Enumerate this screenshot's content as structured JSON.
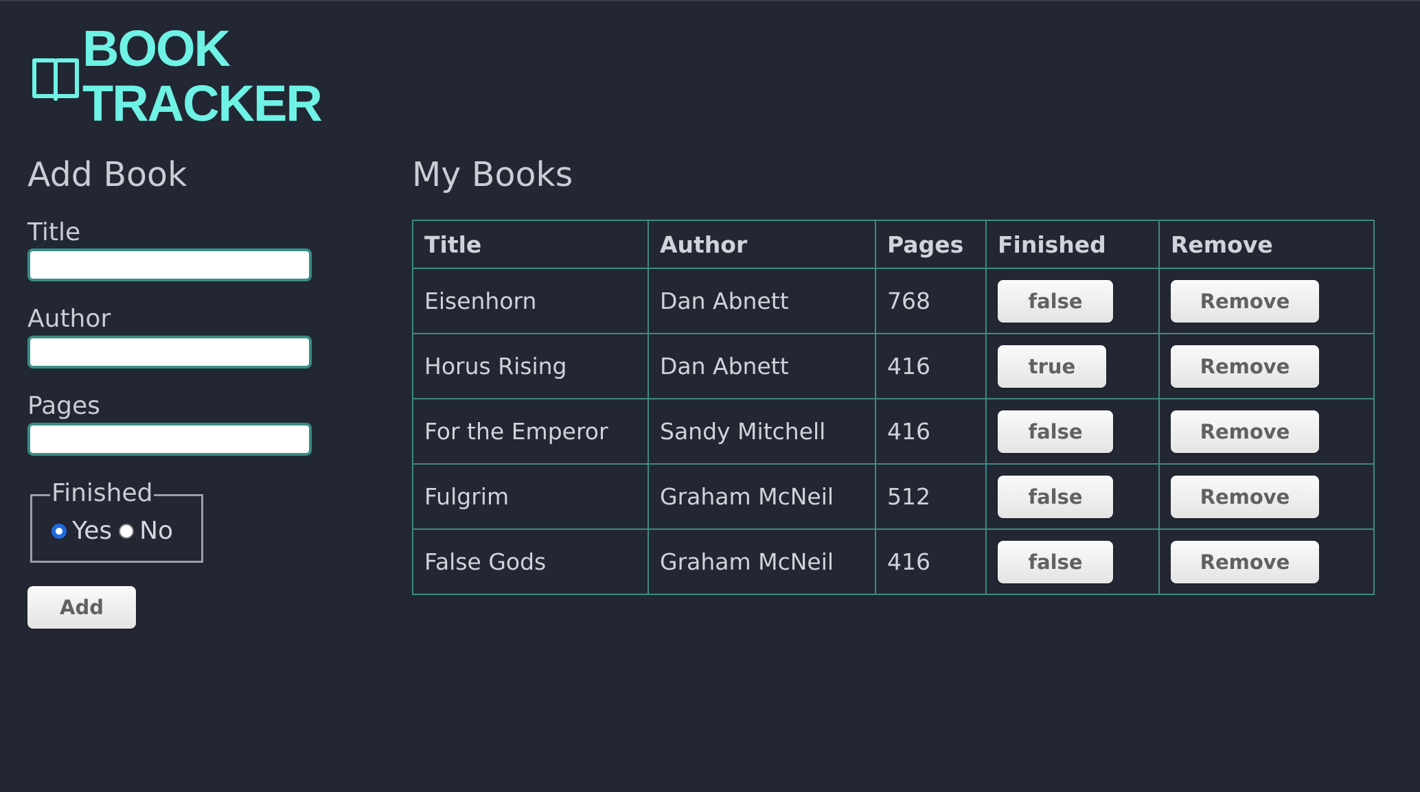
{
  "app": {
    "logo_line1": "BOOK",
    "logo_line2": "TRACKER",
    "logo_icon": "open-book-icon",
    "accent_color": "#6ff2e6",
    "background_color": "#222733"
  },
  "add_book": {
    "heading": "Add Book",
    "title_label": "Title",
    "title_value": "",
    "author_label": "Author",
    "author_value": "",
    "pages_label": "Pages",
    "pages_value": "",
    "finished_legend": "Finished",
    "yes_label": "Yes",
    "no_label": "No",
    "finished_selected": "Yes",
    "add_label": "Add"
  },
  "my_books": {
    "heading": "My Books",
    "columns": [
      "Title",
      "Author",
      "Pages",
      "Finished",
      "Remove"
    ],
    "rows": [
      {
        "title": "Eisenhorn",
        "author": "Dan Abnett",
        "pages": "768",
        "finished": "false",
        "remove": "Remove"
      },
      {
        "title": "Horus Rising",
        "author": "Dan Abnett",
        "pages": "416",
        "finished": "true",
        "remove": "Remove"
      },
      {
        "title": "For the Emperor",
        "author": "Sandy Mitchell",
        "pages": "416",
        "finished": "false",
        "remove": "Remove"
      },
      {
        "title": "Fulgrim",
        "author": "Graham McNeil",
        "pages": "512",
        "finished": "false",
        "remove": "Remove"
      },
      {
        "title": "False Gods",
        "author": "Graham McNeil",
        "pages": "416",
        "finished": "false",
        "remove": "Remove"
      }
    ]
  }
}
